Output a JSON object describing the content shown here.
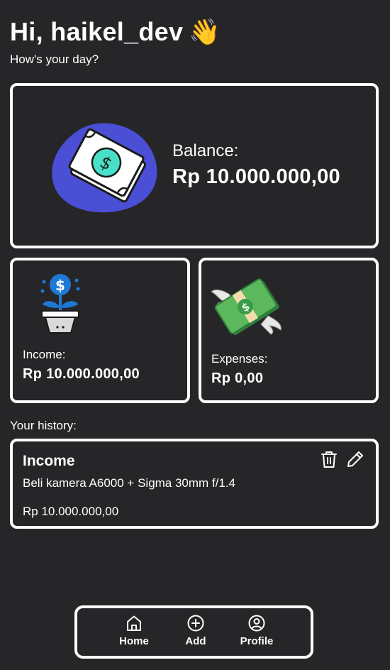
{
  "header": {
    "greeting": "Hi, haikel_dev",
    "wave_emoji": "👋",
    "subtitle": "How's your day?"
  },
  "balance": {
    "label": "Balance:",
    "value": "Rp 10.000.000,00",
    "icon": "money-bill-icon"
  },
  "income": {
    "label": "Income:",
    "value": "Rp 10.000.000,00",
    "icon": "money-plant-icon"
  },
  "expenses": {
    "label": "Expenses:",
    "value": "Rp 0,00",
    "icon": "money-with-wings-icon"
  },
  "history": {
    "label": "Your history:",
    "items": [
      {
        "type": "Income",
        "description": "Beli kamera A6000 + Sigma 30mm f/1.4",
        "amount": "Rp 10.000.000,00"
      }
    ]
  },
  "nav": {
    "items": [
      {
        "label": "Home",
        "icon": "home-icon"
      },
      {
        "label": "Add",
        "icon": "add-circle-icon"
      },
      {
        "label": "Profile",
        "icon": "profile-icon"
      }
    ]
  },
  "colors": {
    "background": "#262629",
    "card_border": "#ffffff",
    "blob_purple": "#4b4fd6",
    "bill_teal": "#48e0c8",
    "bill_green": "#3a9a4a",
    "pot_blue": "#1e78d6"
  }
}
